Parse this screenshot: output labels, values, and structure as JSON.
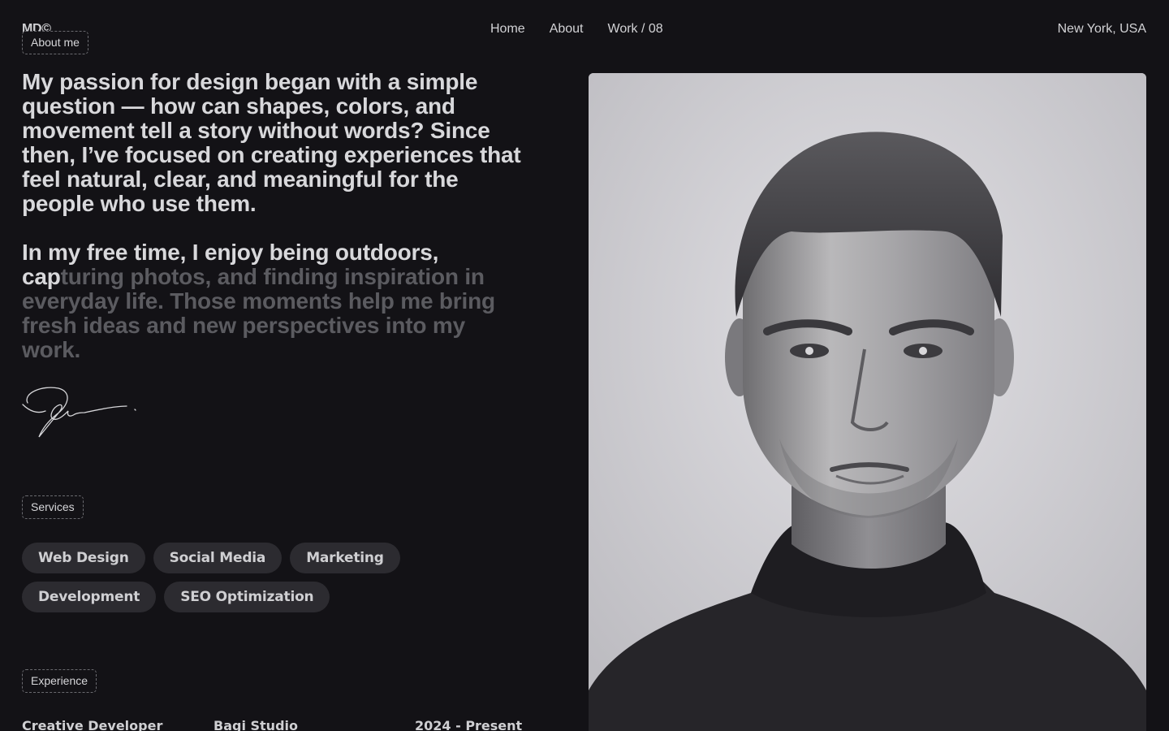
{
  "header": {
    "logo": "MD©",
    "nav": [
      {
        "label": "Home"
      },
      {
        "label": "About"
      },
      {
        "label": "Work / 08"
      }
    ],
    "location": "New York, USA"
  },
  "about": {
    "tag": "About me",
    "paragraph1": "My passion for design began with a simple question — how can shapes, colors, and movement tell a story without words? Since then, I’ve focused on creating experiences that feel natural, clear, and meaningful for the people who use them.",
    "paragraph2_visible": "In my free time, I enjoy being outdoors, cap",
    "paragraph2_dimmed": "turing photos, and finding inspiration in everyday life. Those moments help me bring fresh ideas and new perspectives into my work."
  },
  "services": {
    "tag": "Services",
    "items": [
      "Web Design",
      "Social Media",
      "Marketing",
      "Development",
      "SEO Optimization"
    ]
  },
  "experience": {
    "tag": "Experience",
    "rows": [
      {
        "role": "Creative Developer",
        "company": "Bagi Studio",
        "period": "2024 - Present"
      }
    ]
  },
  "colors": {
    "background": "#131216",
    "text": "#d8d8db",
    "dim_text": "#5b5b60",
    "chip_bg": "#2c2b30",
    "tag_border": "#6a6a6f"
  },
  "icons": {
    "signature": "handwritten-signature",
    "portrait": "black-and-white-portrait-photo"
  }
}
